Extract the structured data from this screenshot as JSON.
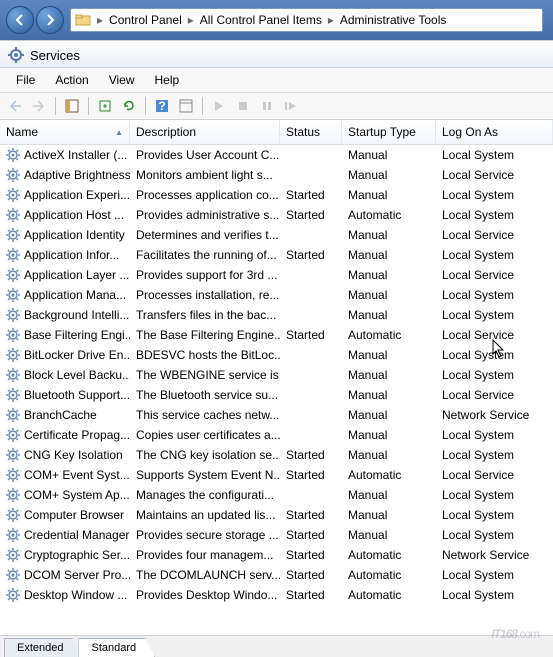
{
  "breadcrumb": {
    "items": [
      "Control Panel",
      "All Control Panel Items",
      "Administrative Tools"
    ]
  },
  "window": {
    "title": "Services"
  },
  "menu": {
    "file": "File",
    "action": "Action",
    "view": "View",
    "help": "Help"
  },
  "columns": {
    "name": "Name",
    "desc": "Description",
    "status": "Status",
    "startup": "Startup Type",
    "logon": "Log On As"
  },
  "tabs": {
    "extended": "Extended",
    "standard": "Standard"
  },
  "watermark": "IT168",
  "watermark_suffix": ".com",
  "services": [
    {
      "name": "ActiveX Installer (...",
      "desc": "Provides User Account C...",
      "status": "",
      "startup": "Manual",
      "logon": "Local System"
    },
    {
      "name": "Adaptive Brightness",
      "desc": "Monitors ambient light s...",
      "status": "",
      "startup": "Manual",
      "logon": "Local Service"
    },
    {
      "name": "Application Experi...",
      "desc": "Processes application co...",
      "status": "Started",
      "startup": "Manual",
      "logon": "Local System"
    },
    {
      "name": "Application Host ...",
      "desc": "Provides administrative s...",
      "status": "Started",
      "startup": "Automatic",
      "logon": "Local System"
    },
    {
      "name": "Application Identity",
      "desc": "Determines and verifies t...",
      "status": "",
      "startup": "Manual",
      "logon": "Local Service"
    },
    {
      "name": "Application Infor...",
      "desc": "Facilitates the running of...",
      "status": "Started",
      "startup": "Manual",
      "logon": "Local System"
    },
    {
      "name": "Application Layer ...",
      "desc": "Provides support for 3rd ...",
      "status": "",
      "startup": "Manual",
      "logon": "Local Service"
    },
    {
      "name": "Application Mana...",
      "desc": "Processes installation, re...",
      "status": "",
      "startup": "Manual",
      "logon": "Local System"
    },
    {
      "name": "Background Intelli...",
      "desc": "Transfers files in the bac...",
      "status": "",
      "startup": "Manual",
      "logon": "Local System"
    },
    {
      "name": "Base Filtering Engi...",
      "desc": "The Base Filtering Engine...",
      "status": "Started",
      "startup": "Automatic",
      "logon": "Local Service"
    },
    {
      "name": "BitLocker Drive En...",
      "desc": "BDESVC hosts the BitLoc...",
      "status": "",
      "startup": "Manual",
      "logon": "Local System"
    },
    {
      "name": "Block Level Backu...",
      "desc": "The WBENGINE service is...",
      "status": "",
      "startup": "Manual",
      "logon": "Local System"
    },
    {
      "name": "Bluetooth Support...",
      "desc": "The Bluetooth service su...",
      "status": "",
      "startup": "Manual",
      "logon": "Local Service"
    },
    {
      "name": "BranchCache",
      "desc": "This service caches netw...",
      "status": "",
      "startup": "Manual",
      "logon": "Network Service"
    },
    {
      "name": "Certificate Propag...",
      "desc": "Copies user certificates a...",
      "status": "",
      "startup": "Manual",
      "logon": "Local System"
    },
    {
      "name": "CNG Key Isolation",
      "desc": "The CNG key isolation se...",
      "status": "Started",
      "startup": "Manual",
      "logon": "Local System"
    },
    {
      "name": "COM+ Event Syst...",
      "desc": "Supports System Event N...",
      "status": "Started",
      "startup": "Automatic",
      "logon": "Local Service"
    },
    {
      "name": "COM+ System Ap...",
      "desc": "Manages the configurati...",
      "status": "",
      "startup": "Manual",
      "logon": "Local System"
    },
    {
      "name": "Computer Browser",
      "desc": "Maintains an updated lis...",
      "status": "Started",
      "startup": "Manual",
      "logon": "Local System"
    },
    {
      "name": "Credential Manager",
      "desc": "Provides secure storage ...",
      "status": "Started",
      "startup": "Manual",
      "logon": "Local System"
    },
    {
      "name": "Cryptographic Ser...",
      "desc": "Provides four managem...",
      "status": "Started",
      "startup": "Automatic",
      "logon": "Network Service"
    },
    {
      "name": "DCOM Server Pro...",
      "desc": "The DCOMLAUNCH serv...",
      "status": "Started",
      "startup": "Automatic",
      "logon": "Local System"
    },
    {
      "name": "Desktop Window ...",
      "desc": "Provides Desktop Windo...",
      "status": "Started",
      "startup": "Automatic",
      "logon": "Local System"
    }
  ]
}
